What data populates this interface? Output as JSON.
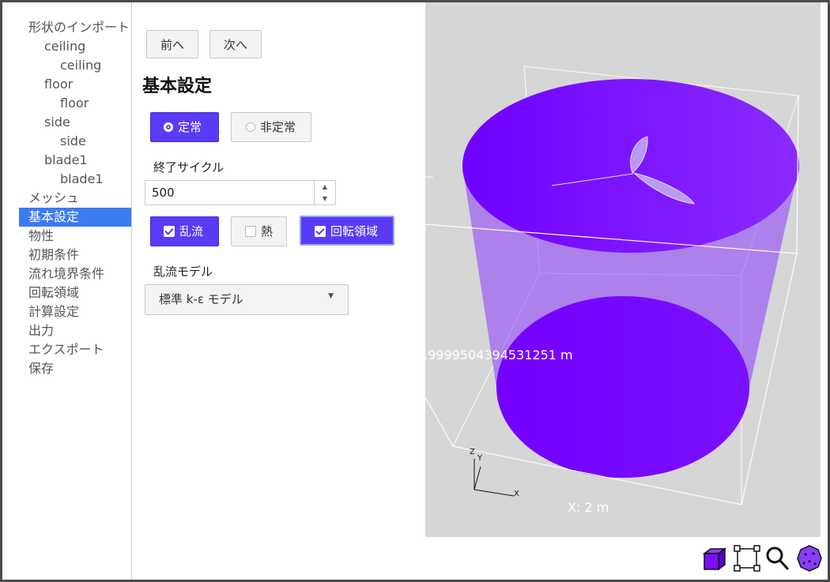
{
  "sidebar": {
    "items": [
      {
        "label": "形状のインポート",
        "level": 1,
        "name": "sidebar-item-import"
      },
      {
        "label": "ceiling",
        "level": 2,
        "name": "sidebar-item-ceiling"
      },
      {
        "label": "ceiling",
        "level": 3,
        "name": "sidebar-item-ceiling-child"
      },
      {
        "label": "floor",
        "level": 2,
        "name": "sidebar-item-floor"
      },
      {
        "label": "floor",
        "level": 3,
        "name": "sidebar-item-floor-child"
      },
      {
        "label": "side",
        "level": 2,
        "name": "sidebar-item-side"
      },
      {
        "label": "side",
        "level": 3,
        "name": "sidebar-item-side-child"
      },
      {
        "label": "blade1",
        "level": 2,
        "name": "sidebar-item-blade1"
      },
      {
        "label": "blade1",
        "level": 3,
        "name": "sidebar-item-blade1-child"
      },
      {
        "label": "メッシュ",
        "level": 1,
        "name": "sidebar-item-mesh"
      },
      {
        "label": "基本設定",
        "level": 1,
        "name": "sidebar-item-basic-settings",
        "active": true
      },
      {
        "label": "物性",
        "level": 1,
        "name": "sidebar-item-properties"
      },
      {
        "label": "初期条件",
        "level": 1,
        "name": "sidebar-item-initial-conditions"
      },
      {
        "label": "流れ境界条件",
        "level": 1,
        "name": "sidebar-item-boundary-conditions"
      },
      {
        "label": "回転領域",
        "level": 1,
        "name": "sidebar-item-rotating-region"
      },
      {
        "label": "計算設定",
        "level": 1,
        "name": "sidebar-item-calc-settings"
      },
      {
        "label": "出力",
        "level": 1,
        "name": "sidebar-item-output"
      },
      {
        "label": "エクスポート",
        "level": 1,
        "name": "sidebar-item-export"
      },
      {
        "label": "保存",
        "level": 1,
        "name": "sidebar-item-save"
      }
    ]
  },
  "nav": {
    "prev_label": "前へ",
    "next_label": "次へ"
  },
  "page_title": "基本設定",
  "time_mode": {
    "steady_label": "定常",
    "unsteady_label": "非定常",
    "selected": "steady"
  },
  "end_cycle": {
    "label": "終了サイクル",
    "value": "500",
    "up": "▲",
    "down": "▼"
  },
  "physics": {
    "turbulence_label": "乱流",
    "heat_label": "熱",
    "rotating_label": "回転領域",
    "turbulence": true,
    "heat": false,
    "rotating": true
  },
  "turbulence_model": {
    "label": "乱流モデル",
    "selected": "標準 k-ε モデル",
    "caret": "▼"
  },
  "viewport": {
    "dimension_label": ".9999504394531251 m",
    "x_dimension_label": "X: 2 m",
    "axis_x": "X",
    "axis_y": "Y",
    "axis_z": "Z"
  },
  "colors": {
    "accent": "#5b3af5",
    "solid": "#7a10ff",
    "active_item": "#3b7bf0",
    "viewport_bg": "#d6d6d6"
  },
  "toolbar": [
    "solid-view-icon",
    "bounding-box-icon",
    "zoom-icon",
    "fit-view-icon"
  ]
}
